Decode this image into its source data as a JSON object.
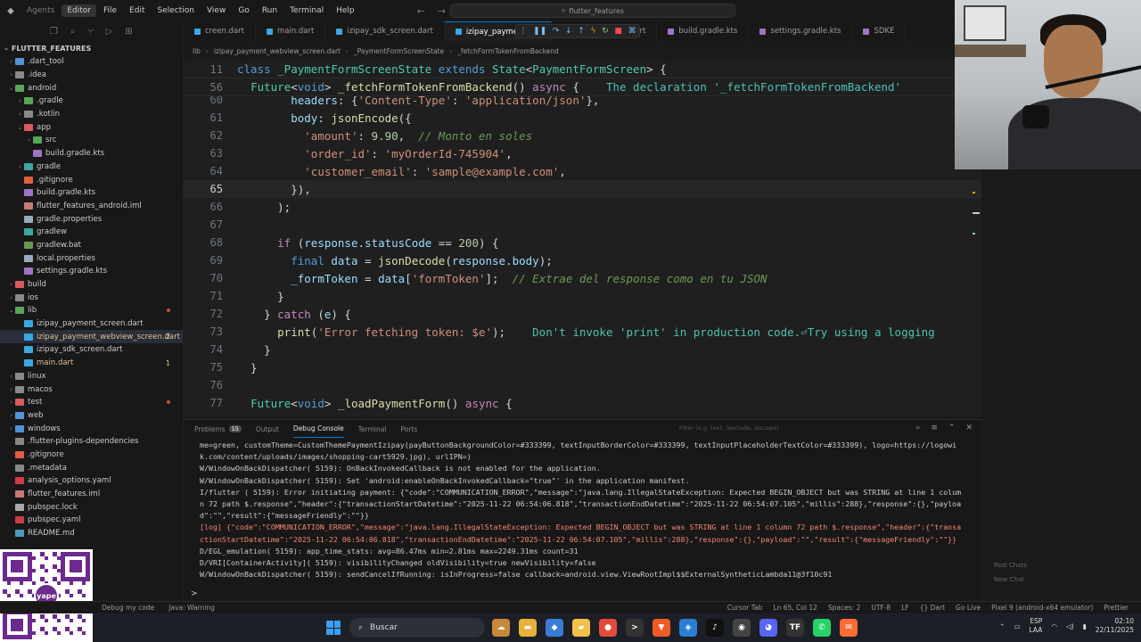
{
  "titlebar": {
    "menu": [
      "Agents",
      "Editor",
      "File",
      "Edit",
      "Selection",
      "View",
      "Go",
      "Run",
      "Terminal",
      "Help"
    ],
    "search_text": "flutter_features"
  },
  "explorer": {
    "title": "FLUTTER_FEATURES",
    "items": [
      {
        "label": ".dart_tool",
        "indent": 0,
        "chev": "›",
        "icon": "fi-folder-blue",
        "color": ""
      },
      {
        "label": ".idea",
        "indent": 0,
        "chev": "›",
        "icon": "fi-folder-gray",
        "color": ""
      },
      {
        "label": "android",
        "indent": 0,
        "chev": "⌄",
        "icon": "fi-folder-green",
        "color": ""
      },
      {
        "label": ".gradle",
        "indent": 1,
        "chev": "›",
        "icon": "fi-folder-green",
        "color": ""
      },
      {
        "label": ".kotlin",
        "indent": 1,
        "chev": "›",
        "icon": "fi-folder-gray",
        "color": ""
      },
      {
        "label": "app",
        "indent": 1,
        "chev": "⌄",
        "icon": "fi-folder-red",
        "color": ""
      },
      {
        "label": "src",
        "indent": 2,
        "chev": "›",
        "icon": "fi-folder-green",
        "color": ""
      },
      {
        "label": "build.gradle.kts",
        "indent": 2,
        "chev": "",
        "icon": "fi-kts",
        "color": ""
      },
      {
        "label": "gradle",
        "indent": 1,
        "chev": "›",
        "icon": "fi-gradle",
        "color": ""
      },
      {
        "label": ".gitignore",
        "indent": 1,
        "chev": "",
        "icon": "fi-git",
        "color": ""
      },
      {
        "label": "build.gradle.kts",
        "indent": 1,
        "chev": "",
        "icon": "fi-kts",
        "color": ""
      },
      {
        "label": "flutter_features_android.iml",
        "indent": 1,
        "chev": "",
        "icon": "fi-iml",
        "color": ""
      },
      {
        "label": "gradle.properties",
        "indent": 1,
        "chev": "",
        "icon": "fi-props",
        "color": ""
      },
      {
        "label": "gradlew",
        "indent": 1,
        "chev": "",
        "icon": "fi-gradle",
        "color": ""
      },
      {
        "label": "gradlew.bat",
        "indent": 1,
        "chev": "",
        "icon": "fi-bat",
        "color": ""
      },
      {
        "label": "local.properties",
        "indent": 1,
        "chev": "",
        "icon": "fi-props",
        "color": ""
      },
      {
        "label": "settings.gradle.kts",
        "indent": 1,
        "chev": "",
        "icon": "fi-kts",
        "color": ""
      },
      {
        "label": "build",
        "indent": 0,
        "chev": "›",
        "icon": "fi-folder-red",
        "color": ""
      },
      {
        "label": "ios",
        "indent": 0,
        "chev": "›",
        "icon": "fi-folder-gray",
        "color": ""
      },
      {
        "label": "lib",
        "indent": 0,
        "chev": "⌄",
        "icon": "fi-folder-green",
        "color": "",
        "dot": true
      },
      {
        "label": "izipay_payment_screen.dart",
        "indent": 1,
        "chev": "",
        "icon": "fi-dart",
        "color": ""
      },
      {
        "label": "izipay_payment_webview_screen.dart",
        "indent": 1,
        "chev": "",
        "icon": "fi-dart",
        "color": "c-yellow",
        "badge": "2",
        "selected": true
      },
      {
        "label": "izipay_sdk_screen.dart",
        "indent": 1,
        "chev": "",
        "icon": "fi-dart",
        "color": ""
      },
      {
        "label": "main.dart",
        "indent": 1,
        "chev": "",
        "icon": "fi-dart",
        "color": "c-yellow",
        "badge": "1"
      },
      {
        "label": "linux",
        "indent": 0,
        "chev": "›",
        "icon": "fi-folder-gray",
        "color": ""
      },
      {
        "label": "macos",
        "indent": 0,
        "chev": "›",
        "icon": "fi-folder-gray",
        "color": ""
      },
      {
        "label": "test",
        "indent": 0,
        "chev": "›",
        "icon": "fi-folder-red",
        "color": "",
        "dot": true
      },
      {
        "label": "web",
        "indent": 0,
        "chev": "›",
        "icon": "fi-folder-blue",
        "color": ""
      },
      {
        "label": "windows",
        "indent": 0,
        "chev": "›",
        "icon": "fi-folder-blue",
        "color": ""
      },
      {
        "label": ".flutter-plugins-dependencies",
        "indent": 0,
        "chev": "",
        "icon": "fi-meta",
        "color": ""
      },
      {
        "label": ".gitignore",
        "indent": 0,
        "chev": "",
        "icon": "fi-git",
        "color": ""
      },
      {
        "label": ".metadata",
        "indent": 0,
        "chev": "",
        "icon": "fi-meta",
        "color": ""
      },
      {
        "label": "analysis_options.yaml",
        "indent": 0,
        "chev": "",
        "icon": "fi-yaml",
        "color": ""
      },
      {
        "label": "flutter_features.iml",
        "indent": 0,
        "chev": "",
        "icon": "fi-iml",
        "color": ""
      },
      {
        "label": "pubspec.lock",
        "indent": 0,
        "chev": "",
        "icon": "fi-lock",
        "color": ""
      },
      {
        "label": "pubspec.yaml",
        "indent": 0,
        "chev": "",
        "icon": "fi-yaml",
        "color": ""
      },
      {
        "label": "README.md",
        "indent": 0,
        "chev": "",
        "icon": "fi-md",
        "color": ""
      }
    ]
  },
  "qr": {
    "center_label": "yape"
  },
  "tabs": [
    {
      "label": "creen.dart",
      "icon": "#3aa8e0",
      "active": false
    },
    {
      "label": "main.dart",
      "icon": "#3aa8e0",
      "active": false
    },
    {
      "label": "izipay_sdk_screen.dart",
      "icon": "#3aa8e0",
      "active": false
    },
    {
      "label": "izipay_payment_we",
      "icon": "#3aa8e0",
      "active": true
    },
    {
      "label": "_config_model.dart",
      "icon": "#3aa8e0",
      "active": false
    },
    {
      "label": "build.gradle.kts",
      "icon": "#a074c4",
      "active": false
    },
    {
      "label": "settings.gradle.kts",
      "icon": "#a074c4",
      "active": false
    },
    {
      "label": "SDKE",
      "icon": "#a074c4",
      "active": false
    }
  ],
  "breadcrumb": [
    "lib",
    "izipay_payment_webview_screen.dart",
    "_PaymentFormScreenState",
    "_fetchFormTokenFromBackend"
  ],
  "code": {
    "sticky": [
      {
        "ln": "11",
        "tokens": [
          [
            "kw",
            "class "
          ],
          [
            "cls",
            "_PaymentFormScreenState "
          ],
          [
            "kw",
            "extends "
          ],
          [
            "cls",
            "State"
          ],
          [
            "pl",
            "<"
          ],
          [
            "cls",
            "PaymentFormScreen"
          ],
          [
            "pl",
            "> {"
          ]
        ]
      },
      {
        "ln": "56",
        "tokens": [
          [
            "pl",
            "  "
          ],
          [
            "cls",
            "Future"
          ],
          [
            "pl",
            "<"
          ],
          [
            "kw",
            "void"
          ],
          [
            "pl",
            "> "
          ],
          [
            "fn",
            "_fetchFormTokenFromBackend"
          ],
          [
            "pl",
            "() "
          ],
          [
            "kw2",
            "async "
          ],
          [
            "pl",
            "{  "
          ],
          [
            "hint",
            "  The declaration '_fetchFormTokenFromBackend'"
          ]
        ]
      }
    ],
    "lines": [
      {
        "ln": "60",
        "tokens": [
          [
            "pl",
            "        "
          ],
          [
            "var",
            "headers"
          ],
          [
            "pl",
            ": {"
          ],
          [
            "str",
            "'Content-Type'"
          ],
          [
            "pl",
            ": "
          ],
          [
            "str",
            "'application/json'"
          ],
          [
            "pl",
            "},"
          ]
        ]
      },
      {
        "ln": "61",
        "tokens": [
          [
            "pl",
            "        "
          ],
          [
            "var",
            "body"
          ],
          [
            "pl",
            ": "
          ],
          [
            "fn",
            "jsonEncode"
          ],
          [
            "pl",
            "({"
          ]
        ]
      },
      {
        "ln": "62",
        "tokens": [
          [
            "pl",
            "          "
          ],
          [
            "str",
            "'amount'"
          ],
          [
            "pl",
            ": "
          ],
          [
            "num",
            "9.90"
          ],
          [
            "pl",
            ",  "
          ],
          [
            "cmt",
            "// Monto en soles"
          ]
        ]
      },
      {
        "ln": "63",
        "tokens": [
          [
            "pl",
            "          "
          ],
          [
            "str",
            "'order_id'"
          ],
          [
            "pl",
            ": "
          ],
          [
            "str",
            "'myOrderId-745904'"
          ],
          [
            "pl",
            ","
          ]
        ]
      },
      {
        "ln": "64",
        "tokens": [
          [
            "pl",
            "          "
          ],
          [
            "str",
            "'customer_email'"
          ],
          [
            "pl",
            ": "
          ],
          [
            "str",
            "'sample@example.com'"
          ],
          [
            "pl",
            ","
          ]
        ]
      },
      {
        "ln": "65",
        "tokens": [
          [
            "pl",
            "        }),"
          ]
        ],
        "current": true
      },
      {
        "ln": "66",
        "tokens": [
          [
            "pl",
            "      );"
          ]
        ]
      },
      {
        "ln": "67",
        "tokens": [
          [
            "pl",
            ""
          ]
        ]
      },
      {
        "ln": "68",
        "tokens": [
          [
            "pl",
            "      "
          ],
          [
            "kw2",
            "if "
          ],
          [
            "pl",
            "("
          ],
          [
            "var",
            "response"
          ],
          [
            "pl",
            "."
          ],
          [
            "var",
            "statusCode"
          ],
          [
            "pl",
            " == "
          ],
          [
            "num",
            "200"
          ],
          [
            "pl",
            ") {"
          ]
        ]
      },
      {
        "ln": "69",
        "tokens": [
          [
            "pl",
            "        "
          ],
          [
            "kw",
            "final "
          ],
          [
            "var",
            "data"
          ],
          [
            "pl",
            " = "
          ],
          [
            "fn",
            "jsonDecode"
          ],
          [
            "pl",
            "("
          ],
          [
            "var",
            "response"
          ],
          [
            "pl",
            "."
          ],
          [
            "var",
            "body"
          ],
          [
            "pl",
            ");"
          ]
        ]
      },
      {
        "ln": "70",
        "tokens": [
          [
            "pl",
            "        "
          ],
          [
            "var",
            "_formToken"
          ],
          [
            "pl",
            " = "
          ],
          [
            "var",
            "data"
          ],
          [
            "pl",
            "["
          ],
          [
            "str",
            "'formToken'"
          ],
          [
            "pl",
            "];  "
          ],
          [
            "cmt",
            "// Extrae del response como en tu JSON"
          ]
        ]
      },
      {
        "ln": "71",
        "tokens": [
          [
            "pl",
            "      }"
          ]
        ]
      },
      {
        "ln": "72",
        "tokens": [
          [
            "pl",
            "    } "
          ],
          [
            "kw2",
            "catch "
          ],
          [
            "pl",
            "("
          ],
          [
            "var",
            "e"
          ],
          [
            "pl",
            ") {"
          ]
        ]
      },
      {
        "ln": "73",
        "tokens": [
          [
            "pl",
            "      "
          ],
          [
            "fn",
            "print"
          ],
          [
            "pl",
            "("
          ],
          [
            "str",
            "'Error fetching token: $e'"
          ],
          [
            "pl",
            ");  "
          ],
          [
            "hint",
            "  Don't invoke 'print' in production code.⏎Try using a logging"
          ]
        ]
      },
      {
        "ln": "74",
        "tokens": [
          [
            "pl",
            "    }"
          ]
        ]
      },
      {
        "ln": "75",
        "tokens": [
          [
            "pl",
            "  }"
          ]
        ]
      },
      {
        "ln": "76",
        "tokens": [
          [
            "pl",
            ""
          ]
        ]
      },
      {
        "ln": "77",
        "tokens": [
          [
            "pl",
            "  "
          ],
          [
            "cls",
            "Future"
          ],
          [
            "pl",
            "<"
          ],
          [
            "kw",
            "void"
          ],
          [
            "pl",
            "> "
          ],
          [
            "fn",
            "_loadPaymentForm"
          ],
          [
            "pl",
            "() "
          ],
          [
            "kw2",
            "async "
          ],
          [
            "pl",
            "{"
          ]
        ]
      }
    ]
  },
  "panel": {
    "tabs": [
      {
        "label": "Problems",
        "count": "15",
        "active": false
      },
      {
        "label": "Output",
        "count": "",
        "active": false
      },
      {
        "label": "Debug Console",
        "count": "",
        "active": true
      },
      {
        "label": "Terminal",
        "count": "",
        "active": false
      },
      {
        "label": "Ports",
        "count": "",
        "active": false
      }
    ],
    "filter_placeholder": "Filter (e.g. text, !exclude, \\escape)",
    "console_lines": [
      {
        "text": "me=green, customTheme=CustomThemePaymentIzipay(payButtonBackgroundColor=#333399, textInputBorderColor=#333399, textInputPlaceholderTextColor=#333399), logo=https://logowik.com/content/uploads/images/shopping-cart5929.jpg), urlIPN=)",
        "err": false
      },
      {
        "text": "W/WindowOnBackDispatcher( 5159): OnBackInvokedCallback is not enabled for the application.",
        "err": false
      },
      {
        "text": "W/WindowOnBackDispatcher( 5159): Set 'android:enableOnBackInvokedCallback=\"true\"' in the application manifest.",
        "err": false
      },
      {
        "text": "I/flutter ( 5159): Error initiating payment: {\"code\":\"COMMUNICATION_ERROR\",\"message\":\"java.lang.IllegalStateException: Expected BEGIN_OBJECT but was STRING at line 1 column 72 path $.response\",\"header\":{\"transactionStartDatetime\":\"2025-11-22 06:54:06.818\",\"transactionEndDatetime\":\"2025-11-22 06:54:07.105\",\"millis\":288},\"response\":{},\"payload\":\"\",\"result\":{\"messageFriendly\":\"\"}}",
        "err": false
      },
      {
        "text": "[log] {\"code\":\"COMMUNICATION_ERROR\",\"message\":\"java.lang.IllegalStateException: Expected BEGIN_OBJECT but was STRING at line 1 column 72 path $.response\",\"header\":{\"transactionStartDatetime\":\"2025-11-22 06:54:06.818\",\"transactionEndDatetime\":\"2025-11-22 06:54:07.105\",\"millis\":288},\"response\":{},\"payload\":\"\",\"result\":{\"messageFriendly\":\"\"}}",
        "err": true
      },
      {
        "text": "D/EGL_emulation( 5159): app_time_stats: avg=86.47ms min=2.81ms max=2249.31ms count=31",
        "err": false
      },
      {
        "text": "D/VRI[ContainerActivity]( 5159): visibilityChanged oldVisibility=true newVisibility=false",
        "err": false
      },
      {
        "text": "W/WindowOnBackDispatcher( 5159): sendCancelIfRunning: isInProgress=false callback=android.view.ViewRootImpl$$ExternalSyntheticLambda11@3f10c91",
        "err": false
      }
    ],
    "prompt": ">",
    "side_labels": [
      "Past Chats",
      "New Chat"
    ]
  },
  "statusbar": {
    "left": [
      "Debug my code",
      "Java: Warning"
    ],
    "right": [
      "Cursor Tab",
      "Ln 65, Col 12",
      "Spaces: 2",
      "UTF-8",
      "LF",
      "{} Dart",
      "Go Live",
      "Pixel 9 (android-x64 emulator)",
      "Prettier"
    ]
  },
  "taskbar": {
    "search_label": "Buscar",
    "apps": [
      {
        "name": "widgets-icon",
        "color": "#c8873a",
        "glyph": "☁"
      },
      {
        "name": "file-explorer-icon",
        "color": "#e8b13c",
        "glyph": "▬"
      },
      {
        "name": "copilot-icon",
        "color": "#3b7bd6",
        "glyph": "◆"
      },
      {
        "name": "folder-icon",
        "color": "#f3c04b",
        "glyph": "▰"
      },
      {
        "name": "chrome-icon",
        "color": "#e24b3b",
        "glyph": "●"
      },
      {
        "name": "terminal-icon",
        "color": "#333",
        "glyph": ">"
      },
      {
        "name": "brave-icon",
        "color": "#f15a24",
        "glyph": "▼"
      },
      {
        "name": "vscode-icon",
        "color": "#2a7fd4",
        "glyph": "◈"
      },
      {
        "name": "tiktok-icon",
        "color": "#111",
        "glyph": "♪"
      },
      {
        "name": "github-icon",
        "color": "#444",
        "glyph": "◉"
      },
      {
        "name": "discord-icon",
        "color": "#5865f2",
        "glyph": "◕"
      },
      {
        "name": "tf-icon",
        "color": "#333",
        "glyph": "TF"
      },
      {
        "name": "whatsapp-icon",
        "color": "#25d366",
        "glyph": "✆"
      },
      {
        "name": "postman-icon",
        "color": "#ff6c37",
        "glyph": "✉"
      }
    ],
    "lang": "ESP",
    "lang2": "LAA",
    "time": "02:10",
    "date": "22/11/2025"
  }
}
